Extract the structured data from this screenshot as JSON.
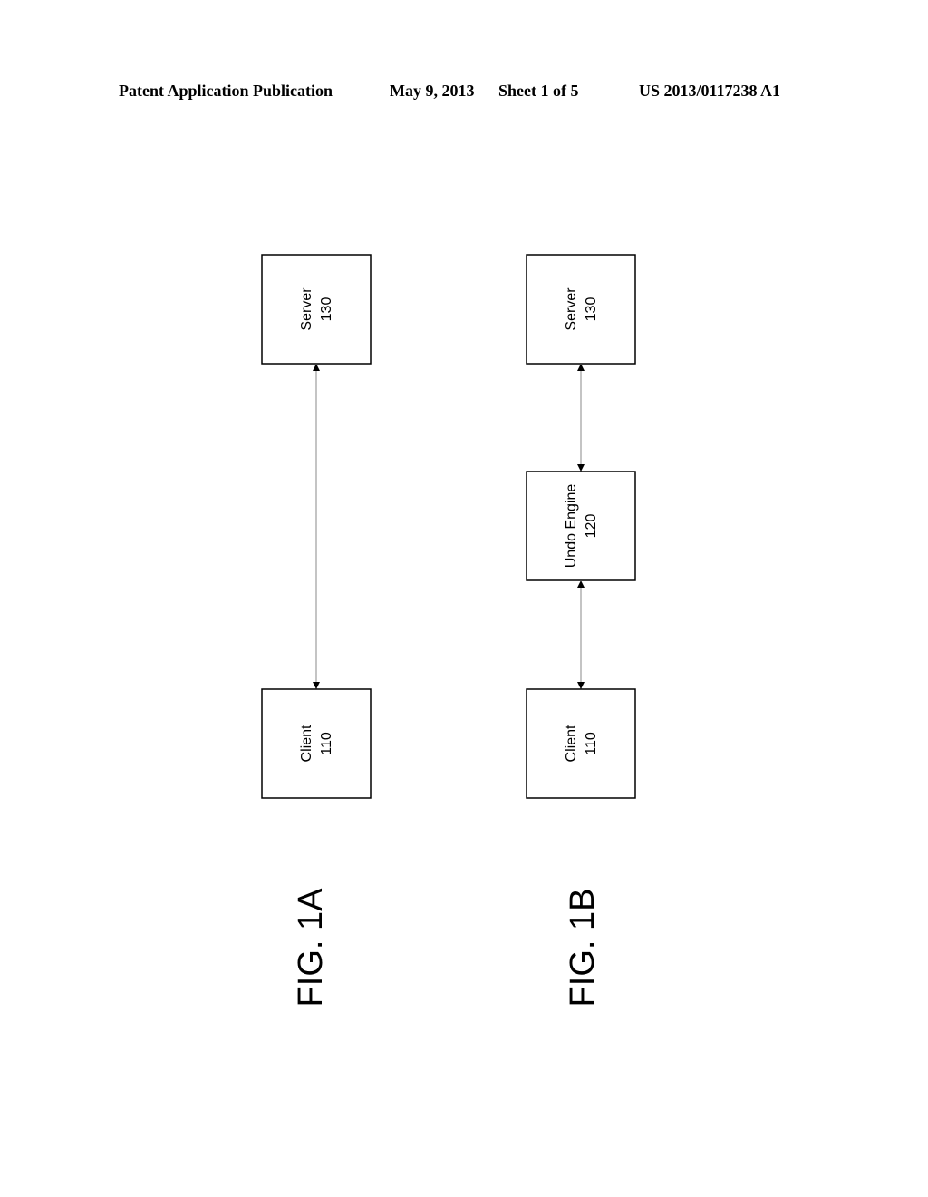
{
  "header": {
    "publication": "Patent Application Publication",
    "date": "May 9, 2013",
    "sheet": "Sheet 1 of 5",
    "number": "US 2013/0117238 A1"
  },
  "figures": [
    {
      "label": "FIG. 1A",
      "boxes": [
        {
          "name": "Server",
          "ref": "130"
        },
        {
          "name": "Client",
          "ref": "110"
        }
      ]
    },
    {
      "label": "FIG. 1B",
      "boxes": [
        {
          "name": "Server",
          "ref": "130"
        },
        {
          "name": "Undo Engine",
          "ref": "120"
        },
        {
          "name": "Client",
          "ref": "110"
        }
      ]
    }
  ]
}
